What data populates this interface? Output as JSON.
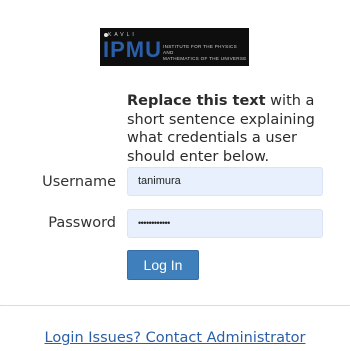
{
  "logo": {
    "kavli": "KAVLI",
    "ipmu": "IPMU",
    "institute_line1": "INSTITUTE FOR THE PHYSICS AND",
    "institute_line2": "MATHEMATICS OF THE UNIVERSE",
    "brand_color": "#2a5fa8"
  },
  "description": {
    "bold": "Replace this text",
    "rest": " with a short sentence explaining what credentials a user should enter below."
  },
  "form": {
    "username_label": "Username",
    "username_value": "tanimura",
    "password_label": "Password",
    "password_value": "••••••••••••",
    "field_background": "#e8f0fe",
    "login_label": "Log In",
    "login_color": "#3f7fbc"
  },
  "footer": {
    "issues_link": "Login Issues? Contact Administrator"
  }
}
